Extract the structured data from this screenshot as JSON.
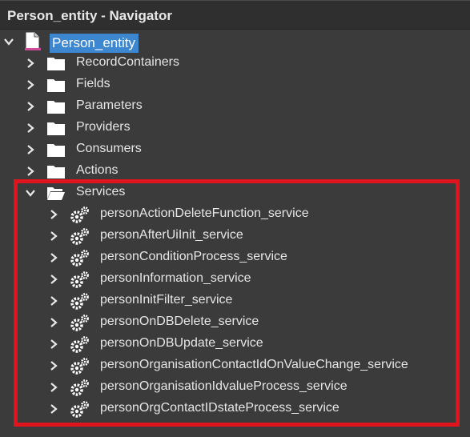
{
  "window": {
    "title": "Person_entity - Navigator"
  },
  "root": {
    "label": "Person_entity"
  },
  "folders": [
    {
      "label": "RecordContainers"
    },
    {
      "label": "Fields"
    },
    {
      "label": "Parameters"
    },
    {
      "label": "Providers"
    },
    {
      "label": "Consumers"
    },
    {
      "label": "Actions"
    }
  ],
  "services": {
    "label": "Services",
    "items": [
      {
        "label": "personActionDeleteFunction_service"
      },
      {
        "label": "personAfterUiInit_service"
      },
      {
        "label": "personConditionProcess_service"
      },
      {
        "label": "personInformation_service"
      },
      {
        "label": "personInitFilter_service"
      },
      {
        "label": "personOnDBDelete_service"
      },
      {
        "label": "personOnDBUpdate_service"
      },
      {
        "label": "personOrganisationContactIdOnValueChange_service"
      },
      {
        "label": "personOrganisationIdvalueProcess_service"
      },
      {
        "label": "personOrgContactIDstateProcess_service"
      }
    ]
  },
  "colors": {
    "background": "#3b3b3b",
    "selection": "#3d86d0",
    "highlight_border": "#e0141c"
  }
}
